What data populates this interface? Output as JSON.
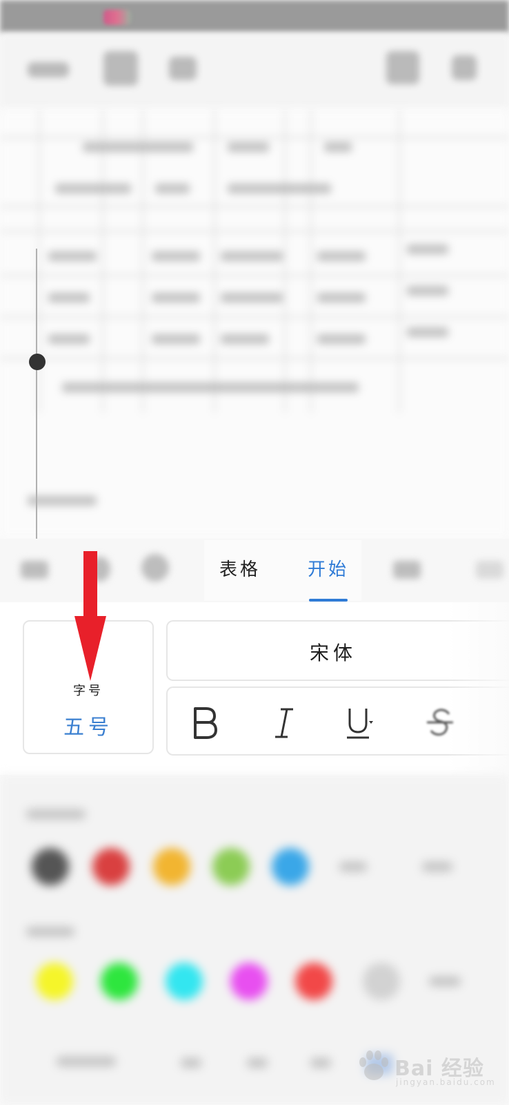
{
  "tabs": [
    {
      "label": "表格",
      "active": false
    },
    {
      "label": "开始",
      "active": true
    }
  ],
  "font_panel": {
    "size_label": "字号",
    "size_value": "五号",
    "font_name": "宋体",
    "styles": [
      "bold",
      "italic",
      "underline",
      "strikethrough"
    ]
  },
  "watermark": {
    "brand": "Bai  经验",
    "url": "jingyan.baidu.com"
  },
  "colors": {
    "accent": "#2f7bd6",
    "arrow": "#e8202a",
    "font_color_swatches": [
      "#555555",
      "#d94040",
      "#f2b531",
      "#8ccc55",
      "#3aa7e8"
    ],
    "highlight_swatches": [
      "#f5f52a",
      "#2ee63e",
      "#33e6f0",
      "#e84ff0",
      "#f24848",
      "#d2d2d2"
    ]
  }
}
